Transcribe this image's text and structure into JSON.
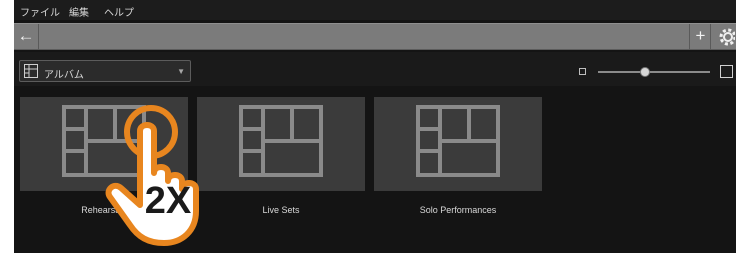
{
  "menu": {
    "items": [
      "ファイル",
      "編集",
      "ヘルプ"
    ]
  },
  "nav": {
    "back_icon": "back-arrow-icon",
    "plus_icon": "plus-icon",
    "gear_icon": "gear-icon"
  },
  "toolbar": {
    "album_selector": {
      "value": "アルバム",
      "icon": "album-grid-icon",
      "arrow": "▼"
    },
    "zoom_level": 0.42
  },
  "albums": [
    {
      "label": "Rehearsals"
    },
    {
      "label": "Live Sets"
    },
    {
      "label": "Solo Performances"
    }
  ],
  "overlay": {
    "gesture_text": "2X",
    "icon": "double-tap-hand-icon"
  },
  "colors": {
    "background": "#141414",
    "tile": "#3b3b3b",
    "navbar": "#7b7b7b",
    "gesture_orange": "#e8861f"
  }
}
